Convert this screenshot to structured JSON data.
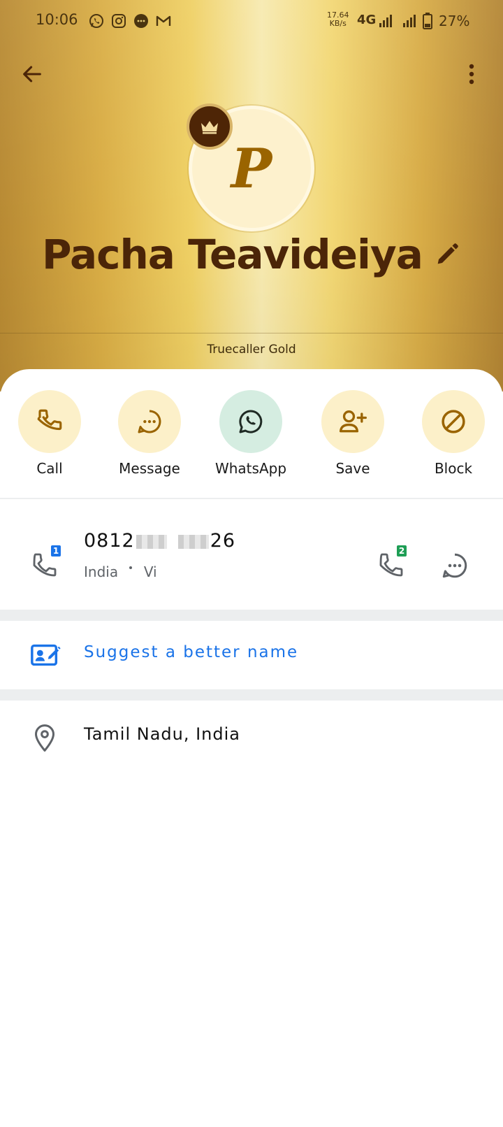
{
  "status_bar": {
    "time": "10:06",
    "net_speed_value": "17.64",
    "net_speed_unit": "KB/s",
    "network_type": "4G",
    "battery": "27%"
  },
  "contact": {
    "avatar_letter": "P",
    "name": "Pacha Teavideiya",
    "badge_label": "Truecaller Gold"
  },
  "actions": [
    {
      "label": "Call",
      "icon": "phone-icon"
    },
    {
      "label": "Message",
      "icon": "message-icon"
    },
    {
      "label": "WhatsApp",
      "icon": "whatsapp-icon"
    },
    {
      "label": "Save",
      "icon": "add-person-icon"
    },
    {
      "label": "Block",
      "icon": "block-icon"
    }
  ],
  "phone": {
    "number_prefix": "0812",
    "number_suffix": "26",
    "carrier_country": "India",
    "carrier_name": "Vi",
    "sim1_label": "1",
    "sim2_label": "2"
  },
  "suggest": {
    "label": "Suggest a better name"
  },
  "location": {
    "text": "Tamil Nadu, India"
  },
  "colors": {
    "name_brown": "#4b2508",
    "icon_gold": "#9a6400",
    "link_blue": "#1a73e8",
    "sim1_blue": "#1a73e8",
    "sim2_green": "#1e9e55"
  }
}
